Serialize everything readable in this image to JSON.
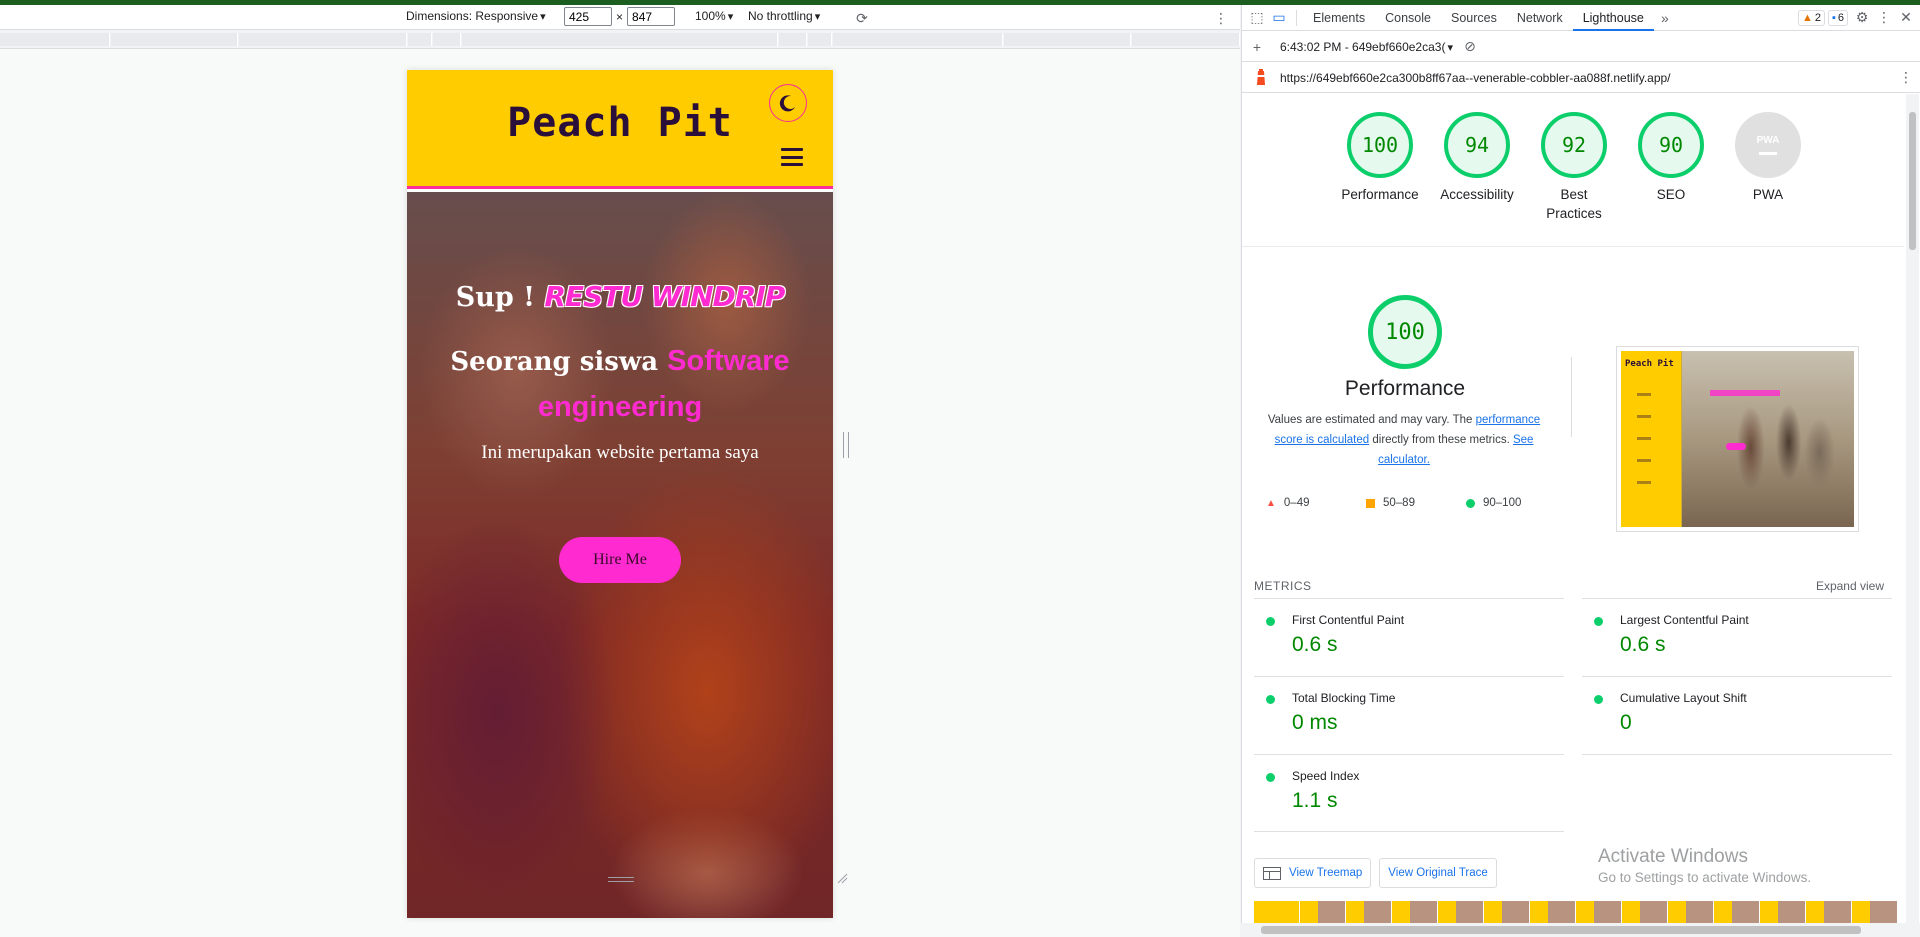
{
  "device_toolbar": {
    "dimensions_label": "Dimensions: Responsive",
    "width_value": "425",
    "times": "×",
    "height_value": "847",
    "zoom": "100%",
    "throttling": "No throttling"
  },
  "site": {
    "title": "Peach Pit",
    "hero_greeting": "Sup !",
    "hero_name": "RESTU WINDRIP",
    "hero_role_prefix": "Seorang siswa",
    "hero_role_highlight": "Software engineering",
    "hero_desc": "Ini merupakan website pertama saya",
    "hire_button": "Hire Me",
    "colors": {
      "header": "#ffcc00",
      "accent": "#ff2bd0",
      "title": "#2a0f3a"
    }
  },
  "devtools": {
    "tabs": [
      "Elements",
      "Console",
      "Sources",
      "Network",
      "Lighthouse"
    ],
    "active_tab": "Lighthouse",
    "warnings_count": "2",
    "messages_count": "6",
    "report_selector": "6:43:02 PM - 649ebf660e2ca3(",
    "url": "https://649ebf660e2ca300b8ff67aa--venerable-cobbler-aa088f.netlify.app/"
  },
  "lighthouse": {
    "scores": [
      {
        "label": "Performance",
        "value": "100"
      },
      {
        "label": "Accessibility",
        "value": "94"
      },
      {
        "label": "Best Practices",
        "value": "92"
      },
      {
        "label": "SEO",
        "value": "90"
      },
      {
        "label": "PWA",
        "value": "PWA"
      }
    ],
    "perf_score": "100",
    "perf_title": "Performance",
    "perf_desc_1": "Values are estimated and may vary. The ",
    "perf_desc_link1": "performance score is calculated",
    "perf_desc_2": " directly from these metrics. ",
    "perf_desc_link2": "See calculator.",
    "legend": [
      "0–49",
      "50–89",
      "90–100"
    ],
    "thumbnail_title": "Peach Pit",
    "metrics_header": "METRICS",
    "expand_view": "Expand view",
    "metrics": [
      {
        "name": "First Contentful Paint",
        "value": "0.6 s"
      },
      {
        "name": "Largest Contentful Paint",
        "value": "0.6 s"
      },
      {
        "name": "Total Blocking Time",
        "value": "0 ms"
      },
      {
        "name": "Cumulative Layout Shift",
        "value": "0"
      },
      {
        "name": "Speed Index",
        "value": "1.1 s"
      }
    ],
    "view_treemap": "View Treemap",
    "view_trace": "View Original Trace",
    "colors": {
      "pass": "#0cce6b",
      "pass_text": "#008800",
      "average": "#ffa400",
      "fail": "#ff4e42"
    }
  },
  "windows": {
    "activate": "Activate Windows",
    "goto": "Go to Settings to activate Windows."
  }
}
